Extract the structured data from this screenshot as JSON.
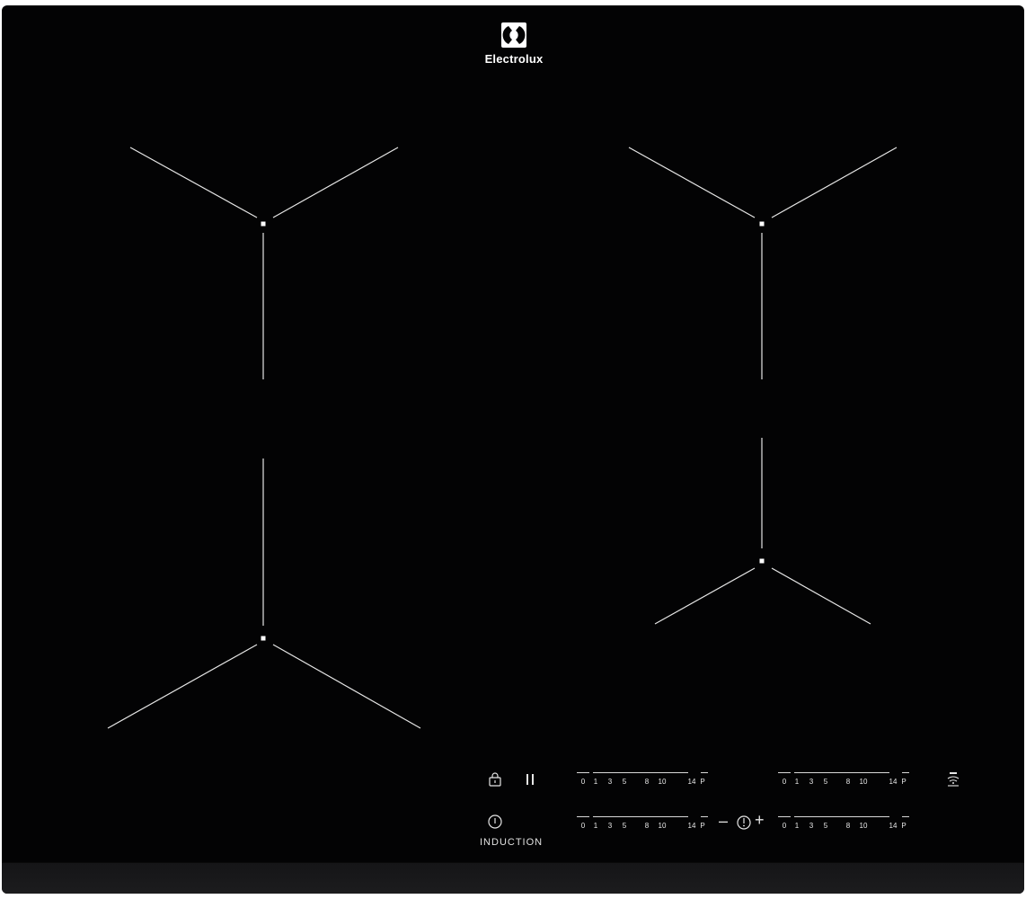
{
  "brand": {
    "name": "Electrolux",
    "logo_icon": "electrolux-logo-icon"
  },
  "controls": {
    "lock_icon": "lock-icon",
    "pause_icon": "pause-icon",
    "power_icon": "power-icon",
    "induction_label": "INDUCTION",
    "hob2hood_icon": "hob2hood-icon",
    "timer": {
      "minus": "–",
      "plus": "+",
      "clock_icon": "timer-clock-icon"
    }
  },
  "power_levels": [
    "0",
    "1",
    "3",
    "5",
    "8",
    "10",
    "14",
    "P"
  ],
  "sliders": [
    {
      "name": "zone-rear-left-slider"
    },
    {
      "name": "zone-rear-right-slider"
    },
    {
      "name": "zone-front-left-slider"
    },
    {
      "name": "zone-front-right-slider"
    }
  ],
  "zones": [
    {
      "name": "zone-rear-left"
    },
    {
      "name": "zone-rear-right"
    },
    {
      "name": "zone-front-left"
    },
    {
      "name": "zone-front-right"
    }
  ],
  "colors": {
    "glass": "#030304",
    "markings": "#e6e6e6",
    "rim": "#1a1a1c"
  }
}
